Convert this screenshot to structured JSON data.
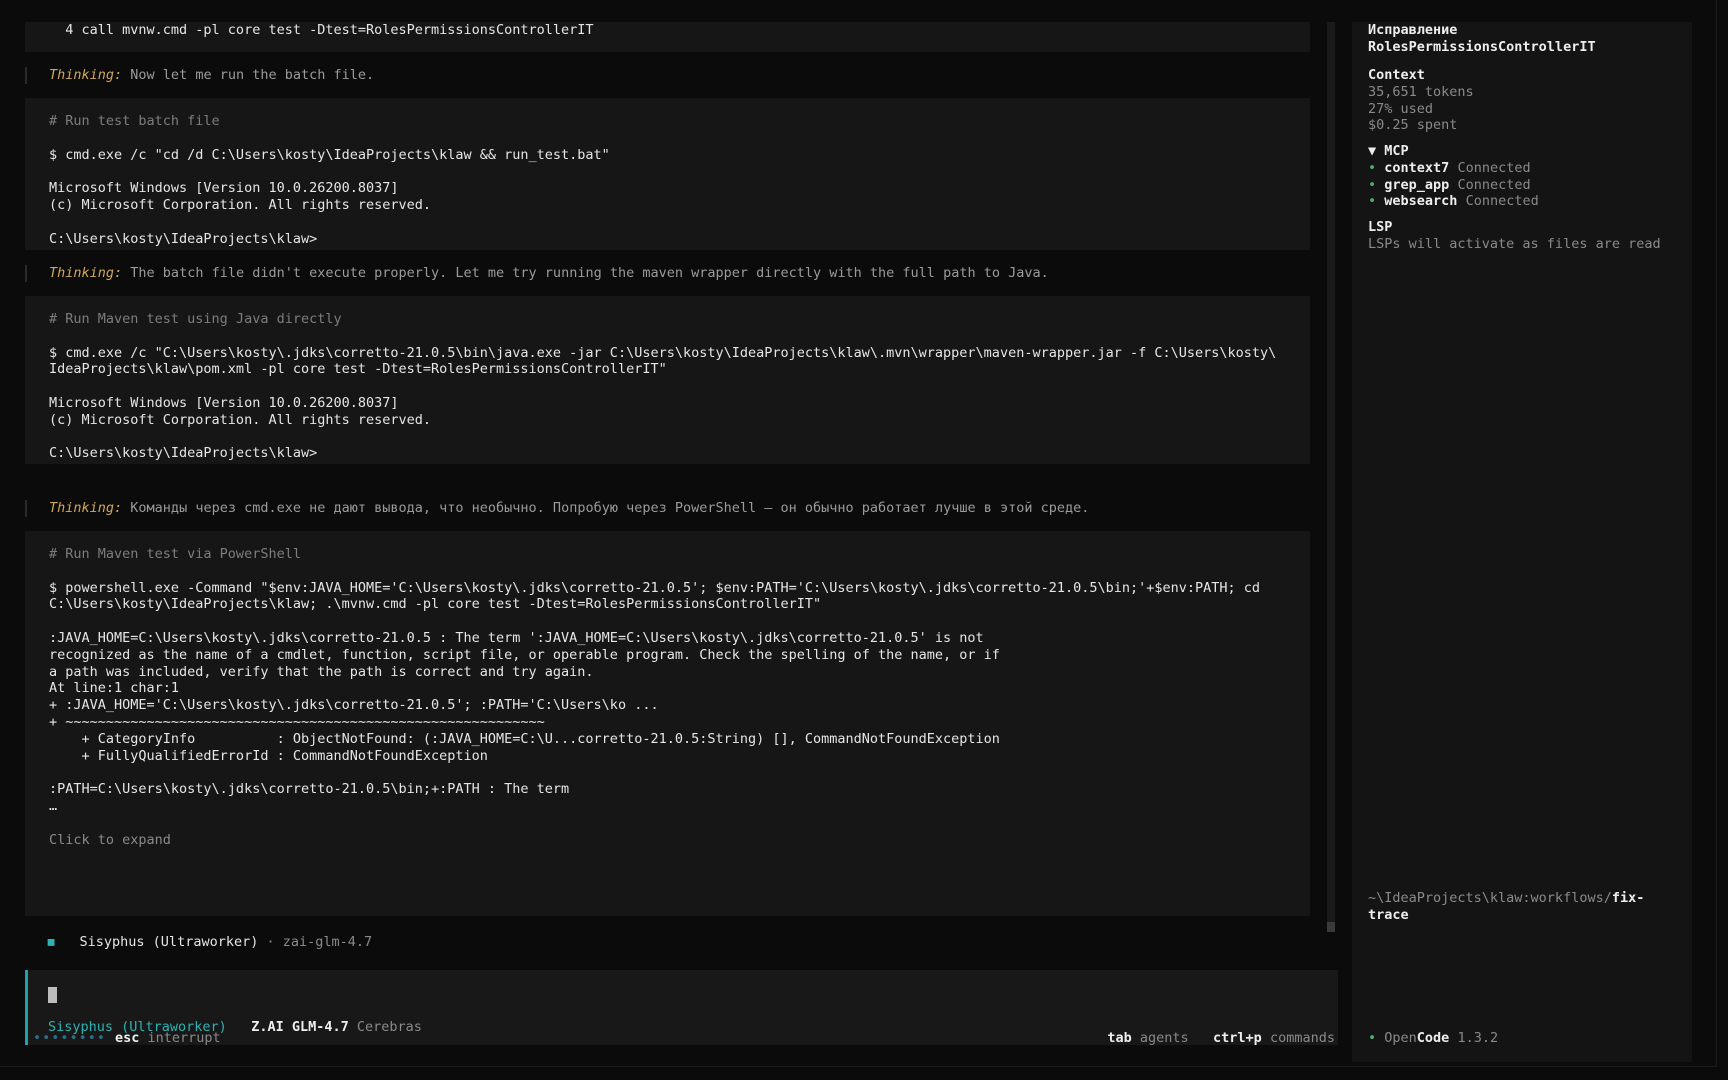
{
  "main": {
    "top_cmd_line": "  4 call mvnw.cmd -pl core test -Dtest=RolesPermissionsControllerIT",
    "thinking_label": "Thinking:",
    "thinking": [
      "Now let me run the batch file.",
      "The batch file didn't execute properly. Let me try running the maven wrapper directly with the full path to Java.",
      "Команды через cmd.exe не дают вывода, что необычно. Попробую через PowerShell – он обычно работает лучше в этой среде."
    ],
    "tool_blocks": [
      {
        "comment": "# Run test batch file",
        "lines": [
          "$ cmd.exe /c \"cd /d C:\\Users\\kosty\\IdeaProjects\\klaw && run_test.bat\"",
          "",
          "Microsoft Windows [Version 10.0.26200.8037]",
          "(c) Microsoft Corporation. All rights reserved.",
          "",
          "C:\\Users\\kosty\\IdeaProjects\\klaw>"
        ]
      },
      {
        "comment": "# Run Maven test using Java directly",
        "lines": [
          "$ cmd.exe /c \"C:\\Users\\kosty\\.jdks\\corretto-21.0.5\\bin\\java.exe -jar C:\\Users\\kosty\\IdeaProjects\\klaw\\.mvn\\wrapper\\maven-wrapper.jar -f C:\\Users\\kosty\\",
          "IdeaProjects\\klaw\\pom.xml -pl core test -Dtest=RolesPermissionsControllerIT\"",
          "",
          "Microsoft Windows [Version 10.0.26200.8037]",
          "(c) Microsoft Corporation. All rights reserved.",
          "",
          "C:\\Users\\kosty\\IdeaProjects\\klaw>"
        ]
      },
      {
        "comment": "# Run Maven test via PowerShell",
        "lines": [
          "$ powershell.exe -Command \"$env:JAVA_HOME='C:\\Users\\kosty\\.jdks\\corretto-21.0.5'; $env:PATH='C:\\Users\\kosty\\.jdks\\corretto-21.0.5\\bin;'+$env:PATH; cd",
          "C:\\Users\\kosty\\IdeaProjects\\klaw; .\\mvnw.cmd -pl core test -Dtest=RolesPermissionsControllerIT\"",
          "",
          ":JAVA_HOME=C:\\Users\\kosty\\.jdks\\corretto-21.0.5 : The term ':JAVA_HOME=C:\\Users\\kosty\\.jdks\\corretto-21.0.5' is not",
          "recognized as the name of a cmdlet, function, script file, or operable program. Check the spelling of the name, or if",
          "a path was included, verify that the path is correct and try again.",
          "At line:1 char:1",
          "+ :JAVA_HOME='C:\\Users\\kosty\\.jdks\\corretto-21.0.5'; :PATH='C:\\Users\\ko ...",
          "+ ~~~~~~~~~~~~~~~~~~~~~~~~~~~~~~~~~~~~~~~~~~~~~~~~~~~~~~~~~~~",
          "    + CategoryInfo          : ObjectNotFound: (:JAVA_HOME=C:\\U...corretto-21.0.5:String) [], CommandNotFoundException",
          "    + FullyQualifiedErrorId : CommandNotFoundException",
          "",
          ":PATH=C:\\Users\\kosty\\.jdks\\corretto-21.0.5\\bin;+:PATH : The term",
          "…"
        ],
        "expand": "Click to expand"
      }
    ],
    "agent_bullet": "◼",
    "agent_name": "Sisyphus (Ultraworker)",
    "agent_sep": "·",
    "agent_model": "zai-glm-4.7"
  },
  "input": {
    "agent": "Sisyphus (Ultraworker)",
    "model": "Z.AI GLM-4.7",
    "provider": "Cerebras"
  },
  "statusbar": {
    "spinner": "••••••••",
    "esc_key": "esc",
    "esc_label": "interrupt",
    "tab_key": "tab",
    "tab_label": "agents",
    "ctrlp_key": "ctrl+p",
    "ctrlp_label": "commands"
  },
  "sidebar": {
    "title_line1": "Исправление",
    "title_line2": "RolesPermissionsControllerIT",
    "context_heading": "Context",
    "tokens": "35,651 tokens",
    "used": "27% used",
    "spent": "$0.25 spent",
    "mcp_heading": "▼ MCP",
    "mcp": [
      {
        "name": "context7",
        "status": "Connected"
      },
      {
        "name": "grep_app",
        "status": "Connected"
      },
      {
        "name": "websearch",
        "status": "Connected"
      }
    ],
    "lsp_heading": "LSP",
    "lsp_text": "LSPs will activate as files are read",
    "path_prefix": "~\\IdeaProjects\\klaw:workflows/",
    "path_branch_1": "fix-",
    "path_branch_2": "trace",
    "app_open": "Open",
    "app_code": "Code",
    "app_version": "1.3.2"
  },
  "colors": {
    "accent": "#2bb3b3",
    "thinking": "#d2a857",
    "connected": "#4fb06a"
  }
}
